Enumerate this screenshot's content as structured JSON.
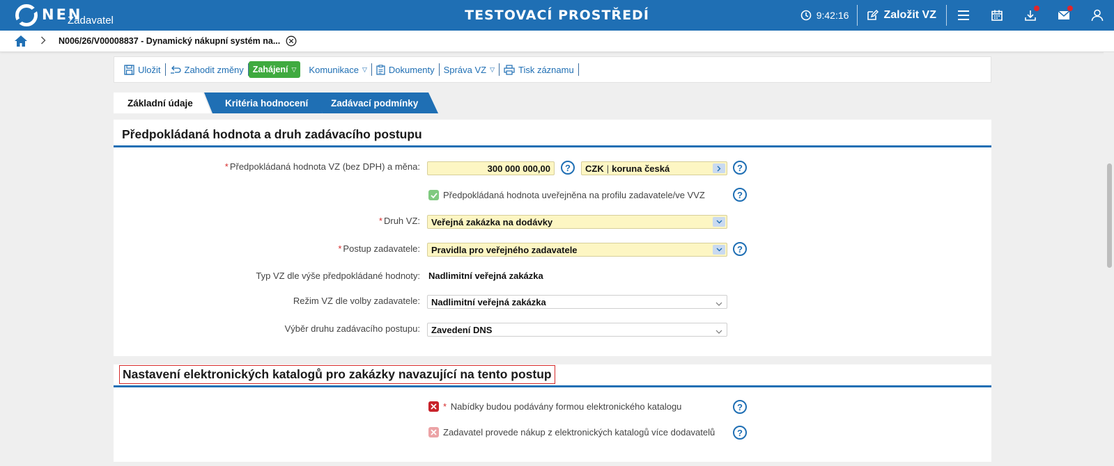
{
  "topbar": {
    "logo": "NEN",
    "logo_sub": "Zadavatel",
    "env_title": "TESTOVACÍ PROSTŘEDÍ",
    "clock": "9:42:16",
    "new_button": "Založit VZ"
  },
  "breadcrumb": {
    "text": "N006/26/V00008837 - Dynamický nákupní systém na..."
  },
  "toolbar": {
    "save": "Uložit",
    "discard": "Zahodit změny",
    "start": "Zahájení",
    "communication": "Komunikace",
    "documents": "Dokumenty",
    "management": "Správa VZ",
    "print": "Tisk záznamu"
  },
  "tabs": [
    "Základní údaje",
    "Kritéria hodnocení",
    "Zadávací podmínky"
  ],
  "section1": {
    "title": "Předpokládaná hodnota a druh zadávacího postupu",
    "value_label": "Předpokládaná hodnota VZ (bez DPH) a měna:",
    "value": "300 000 000,00",
    "currency_code": "CZK",
    "currency_name": "koruna česká",
    "published_label": "Předpokládaná hodnota uveřejněna na profilu zadavatele/ve VVZ",
    "type_label": "Druh VZ:",
    "type_value": "Veřejná zakázka na dodávky",
    "procedure_label": "Postup zadavatele:",
    "procedure_value": "Pravidla pro veřejného zadavatele",
    "size_label": "Typ VZ dle výše předpokládané hodnoty:",
    "size_value": "Nadlimitní veřejná zakázka",
    "regime_label": "Režim VZ dle volby zadavatele:",
    "regime_value": "Nadlimitní veřejná zakázka",
    "selection_label": "Výběr druhu zadávacího postupu:",
    "selection_value": "Zavedení DNS"
  },
  "section2": {
    "title": "Nastavení elektronických katalogů pro zakázky navazující na tento postup",
    "catalog_offers_label": "Nabídky budou podávány formou elektronického katalogu",
    "multi_supplier_label": "Zadavatel provede nákup z elektronických katalogů více dodavatelů"
  },
  "colors": {
    "brand": "#1f6fb4",
    "accent_green": "#3faa3f",
    "required": "#d62b2b",
    "field_yellow": "#fdf6c3"
  },
  "icons": [
    "clock-icon",
    "edit-icon",
    "menu-icon",
    "calendar-icon",
    "download-icon",
    "mail-icon",
    "user-icon",
    "home-icon",
    "close-circle-icon",
    "help-icon"
  ]
}
